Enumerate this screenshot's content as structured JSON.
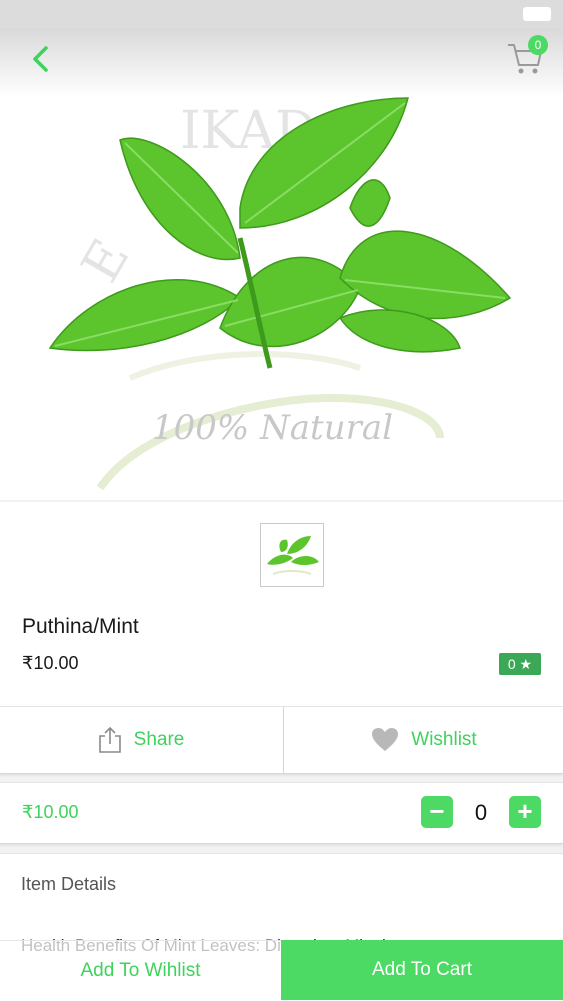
{
  "header": {
    "back_icon": "chevron-left-icon",
    "cart_icon": "shopping-cart-icon",
    "cart_count": "0"
  },
  "hero": {
    "watermark_text": "100% Natural",
    "brand_watermark": "EERAIKADAI.CO"
  },
  "product": {
    "name": "Puthina/Mint",
    "price": "₹10.00",
    "rating_label": "0 ★"
  },
  "actions": {
    "share_label": "Share",
    "share_icon": "share-icon",
    "wishlist_label": "Wishlist",
    "wishlist_icon": "heart-icon"
  },
  "quantity": {
    "price": "₹10.00",
    "minus_label": "−",
    "value": "0",
    "plus_label": "+"
  },
  "details": {
    "title": "Item Details",
    "body": "Health Benefits Of Mint Leaves: Digestion. Mint leaves acts"
  },
  "bottom_bar": {
    "add_to_wishlist_label": "Add To Wihlist",
    "add_to_cart_label": "Add To Cart"
  },
  "colors": {
    "accent": "#4cd964",
    "accent_text": "#3fd25c",
    "rating_bg": "#3aa857"
  }
}
